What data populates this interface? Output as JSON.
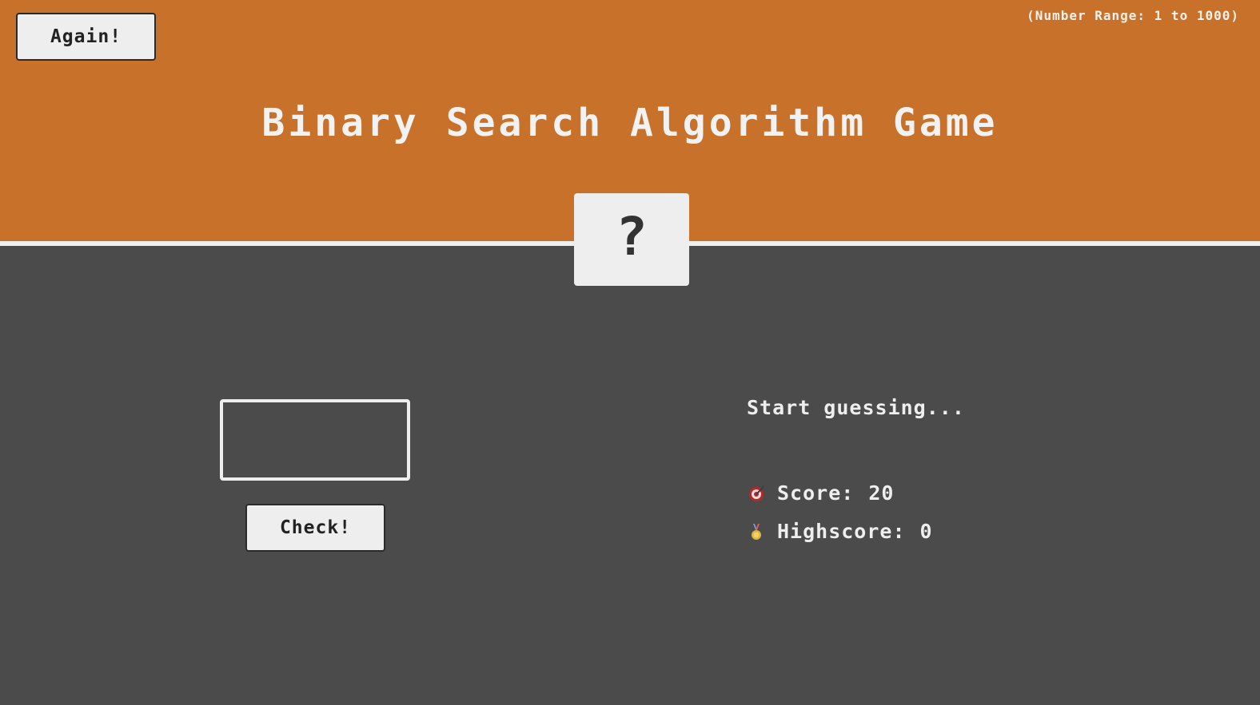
{
  "header": {
    "again_label": "Again!",
    "range_text": "(Number Range: 1 to 1000)",
    "title": "Binary Search Algorithm Game"
  },
  "secret": {
    "display": "?"
  },
  "guess": {
    "value": "",
    "placeholder": ""
  },
  "check_label": "Check!",
  "message": "Start guessing...",
  "score": {
    "label": "Score:",
    "value": "20",
    "icon": "target-icon"
  },
  "highscore": {
    "label": "Highscore:",
    "value": "0",
    "icon": "medal-icon"
  },
  "colors": {
    "header_bg": "#c8712b",
    "body_bg": "#4b4b4b",
    "light": "#eeeeee",
    "dark_text": "#222222"
  }
}
